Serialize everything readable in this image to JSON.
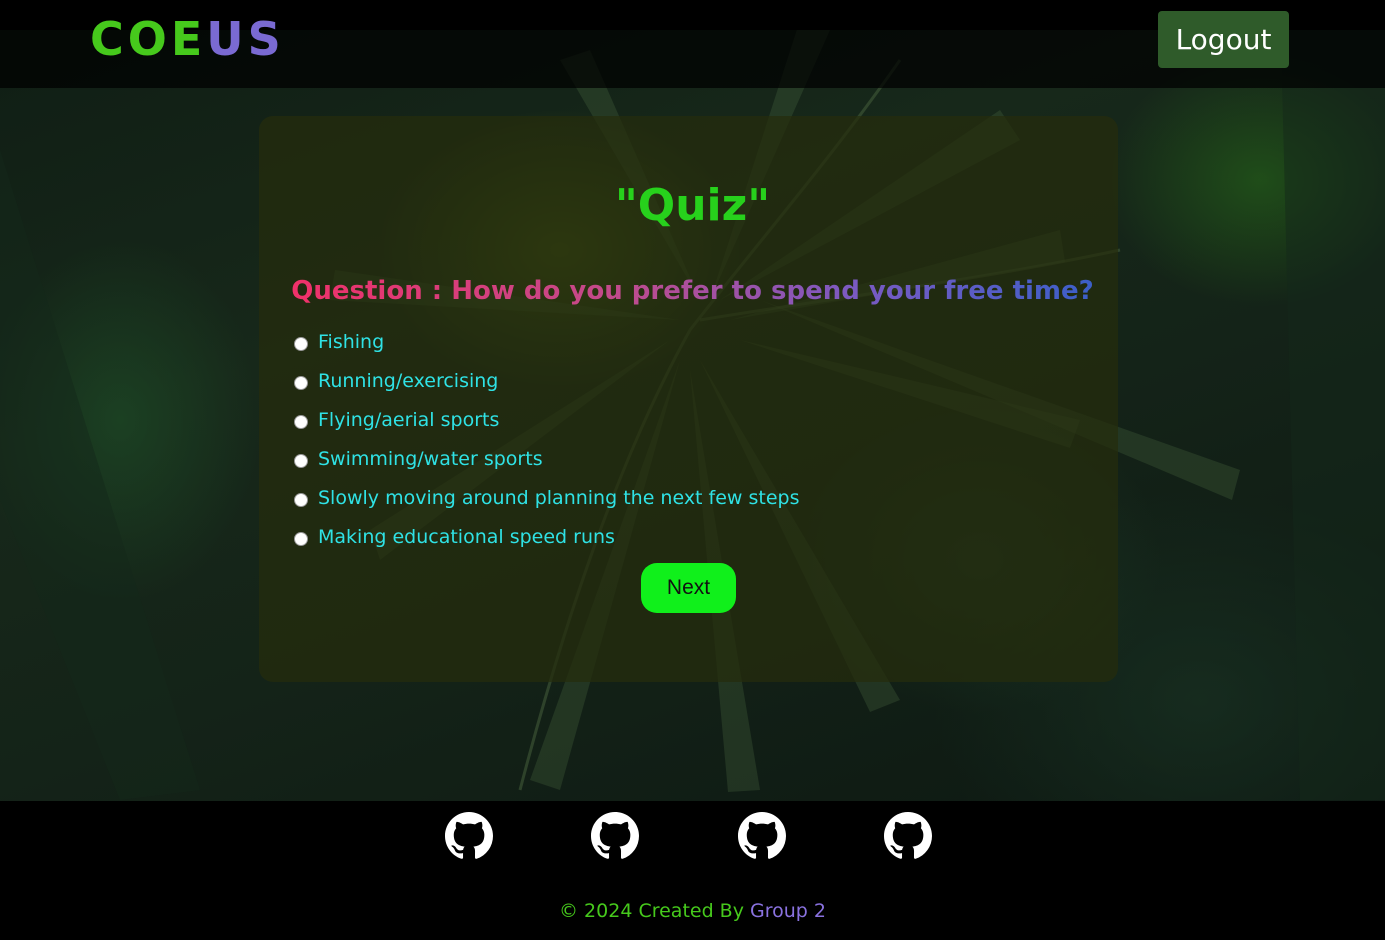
{
  "header": {
    "logo_part1": "COE",
    "logo_part2": "US",
    "logout_label": "Logout"
  },
  "quiz": {
    "title": "\"Quiz\"",
    "question": "Question : How do you prefer to spend your free time?",
    "options": [
      "Fishing",
      "Running/exercising",
      "Flying/aerial sports",
      "Swimming/water sports",
      "Slowly moving around planning the next few steps",
      "Making educational speed runs"
    ],
    "next_label": "Next"
  },
  "footer": {
    "links": [
      "github-icon",
      "github-icon",
      "github-icon",
      "github-icon"
    ],
    "copyright_part1": "© 2024 Created By ",
    "copyright_part2": "Group 2"
  },
  "colors": {
    "logo_green": "#46c91c",
    "logo_purple": "#7a6ad2",
    "quiz_title": "#27d11c",
    "option_text": "#2fe2e5",
    "next_button": "#10f01b",
    "logout_button": "#2f5b2a"
  }
}
